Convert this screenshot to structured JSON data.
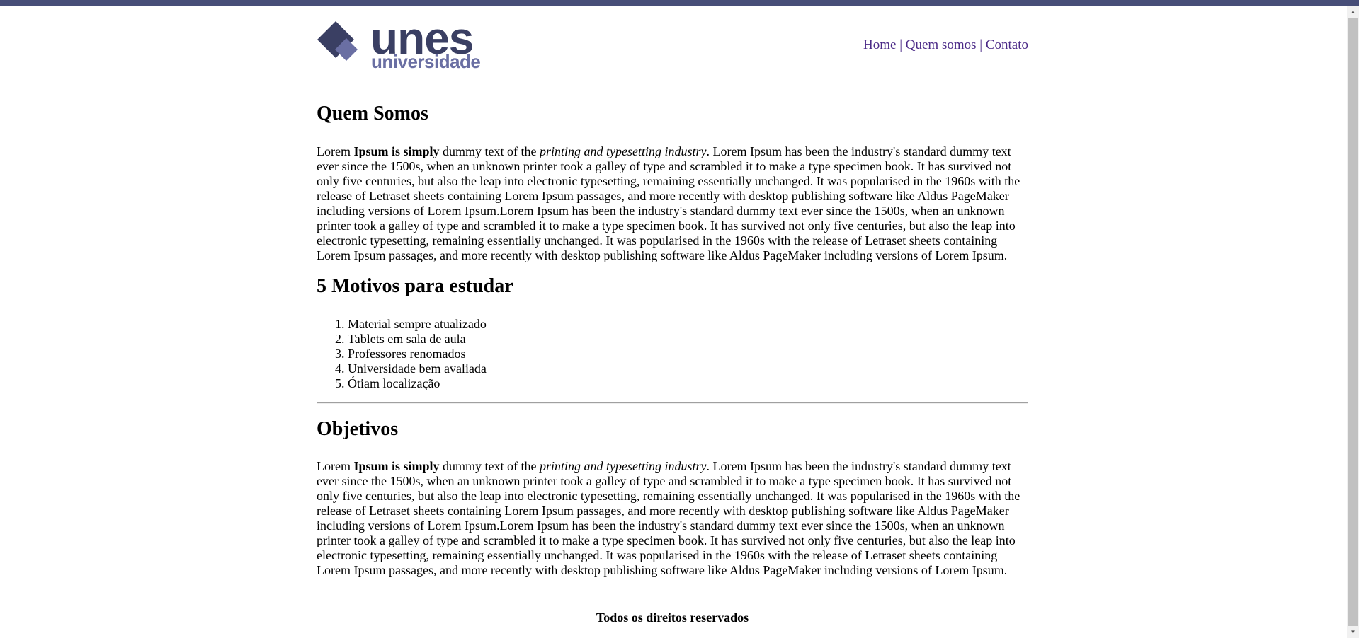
{
  "brand": {
    "name": "unes",
    "tagline": "universidade",
    "color_dark": "#3a3f63",
    "color_light": "#6a6fa3"
  },
  "nav": {
    "items": [
      "Home",
      "Quem somos",
      "Contato"
    ],
    "separator": "|",
    "link_color": "#4b2a88"
  },
  "section_about": {
    "title": "Quem Somos",
    "p_lead": "Lorem ",
    "p_bold": "Ipsum is simply",
    "p_mid": " dummy text of the ",
    "p_italic": "printing and typesetting industry",
    "p_rest": ". Lorem Ipsum has been the industry's standard dummy text ever since the 1500s, when an unknown printer took a galley of type and scrambled it to make a type specimen book. It has survived not only five centuries, but also the leap into electronic typesetting, remaining essentially unchanged. It was popularised in the 1960s with the release of Letraset sheets containing Lorem Ipsum passages, and more recently with desktop publishing software like Aldus PageMaker including versions of Lorem Ipsum.Lorem Ipsum has been the industry's standard dummy text ever since the 1500s, when an unknown printer took a galley of type and scrambled it to make a type specimen book. It has survived not only five centuries, but also the leap into electronic typesetting, remaining essentially unchanged. It was popularised in the 1960s with the release of Letraset sheets containing Lorem Ipsum passages, and more recently with desktop publishing software like Aldus PageMaker including versions of Lorem Ipsum."
  },
  "section_reasons": {
    "title": "5 Motivos para estudar",
    "items": [
      "Material sempre atualizado",
      "Tablets em sala de aula",
      "Professores renomados",
      "Universidade bem avaliada",
      "Ótiam localização"
    ]
  },
  "section_goals": {
    "title": "Objetivos",
    "p_lead": "Lorem ",
    "p_bold": "Ipsum is simply",
    "p_mid": " dummy text of the ",
    "p_italic": "printing and typesetting industry",
    "p_rest": ". Lorem Ipsum has been the industry's standard dummy text ever since the 1500s, when an unknown printer took a galley of type and scrambled it to make a type specimen book. It has survived not only five centuries, but also the leap into electronic typesetting, remaining essentially unchanged. It was popularised in the 1960s with the release of Letraset sheets containing Lorem Ipsum passages, and more recently with desktop publishing software like Aldus PageMaker including versions of Lorem Ipsum.Lorem Ipsum has been the industry's standard dummy text ever since the 1500s, when an unknown printer took a galley of type and scrambled it to make a type specimen book. It has survived not only five centuries, but also the leap into electronic typesetting, remaining essentially unchanged. It was popularised in the 1960s with the release of Letraset sheets containing Lorem Ipsum passages, and more recently with desktop publishing software like Aldus PageMaker including versions of Lorem Ipsum."
  },
  "footer": {
    "text": "Todos os direitos reservados"
  },
  "theme": {
    "top_bar_color": "#474e78"
  }
}
